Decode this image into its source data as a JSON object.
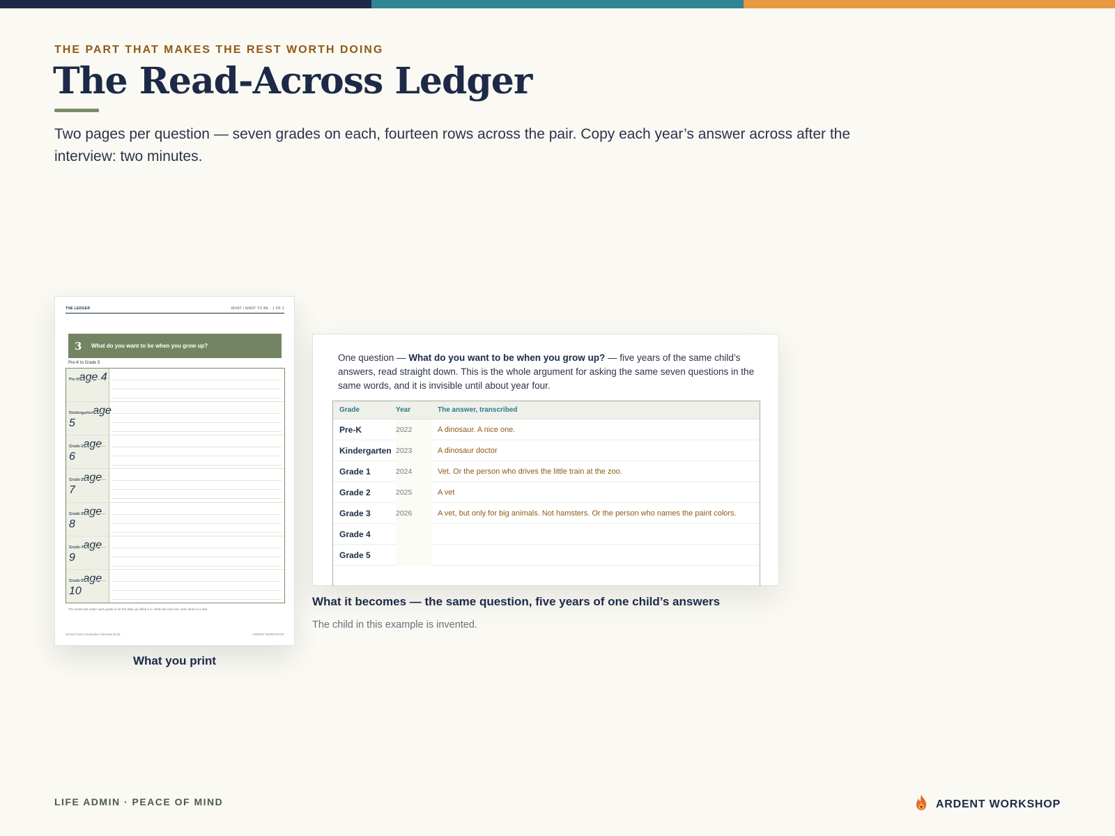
{
  "colors": {
    "navy": "#1c2a47",
    "teal": "#2f8593",
    "orange": "#e9993f",
    "sage": "#738462",
    "amber_text": "#8f5a14"
  },
  "header": {
    "eyebrow": "THE PART THAT MAKES THE REST WORTH DOING",
    "title": "The Read-Across Ledger",
    "lede": "Two pages per question — seven grades on each, fourteen rows across the pair. Copy each year’s answer across after the interview: two minutes."
  },
  "print_page": {
    "running_head_left": "THE LEDGER",
    "running_head_right": "WHAT I WANT TO BE · 1 OF 2",
    "question_number": "3",
    "question": "What do you want to be when you grow up?",
    "range": "Pre-K to Grade 5",
    "rows": [
      {
        "grade": "Pre-K",
        "age": "age 4"
      },
      {
        "grade": "Kindergarten",
        "age": "age 5"
      },
      {
        "grade": "Grade 1",
        "age": "age 6"
      },
      {
        "grade": "Grade 2",
        "age": "age 7"
      },
      {
        "grade": "Grade 3",
        "age": "age 8"
      },
      {
        "grade": "Grade 4",
        "age": "age 9"
      },
      {
        "grade": "Grade 5",
        "age": "age 10"
      }
    ],
    "footnote": "The small rule under each grade is for the date you filled it in. Write the real one, even when it is late.",
    "footer_left": "School-Years Keepsake Interview Book",
    "footer_right": "ARDENT WORKSHOP",
    "caption": "What you print"
  },
  "digital": {
    "intro_pre": "One question — ",
    "intro_bold": "What do you want to be when you grow up?",
    "intro_post": " — five years of the same child’s answers, read straight down. This is the whole argument for asking the same seven questions in the same words, and it is invisible until about year four.",
    "columns": [
      "Grade",
      "Year",
      "The answer, transcribed"
    ],
    "rows": [
      {
        "grade": "Pre-K",
        "year": "2022",
        "answer": "A dinosaur. A nice one."
      },
      {
        "grade": "Kindergarten",
        "year": "2023",
        "answer": "A dinosaur doctor"
      },
      {
        "grade": "Grade 1",
        "year": "2024",
        "answer": "Vet. Or the person who drives the little train at the zoo."
      },
      {
        "grade": "Grade 2",
        "year": "2025",
        "answer": "A vet"
      },
      {
        "grade": "Grade 3",
        "year": "2026",
        "answer": "A vet, but only for big animals. Not hamsters. Or the person who names the paint colors."
      },
      {
        "grade": "Grade 4",
        "year": "",
        "answer": ""
      },
      {
        "grade": "Grade 5",
        "year": "",
        "answer": ""
      }
    ],
    "caption": "What it becomes — the same question, five years of one child’s answers",
    "note": "The child in this example is invented."
  },
  "footer": {
    "left": "LIFE ADMIN · PEACE OF MIND",
    "brand": "ARDENT WORKSHOP",
    "logo_icon": "flame-logo-icon"
  }
}
